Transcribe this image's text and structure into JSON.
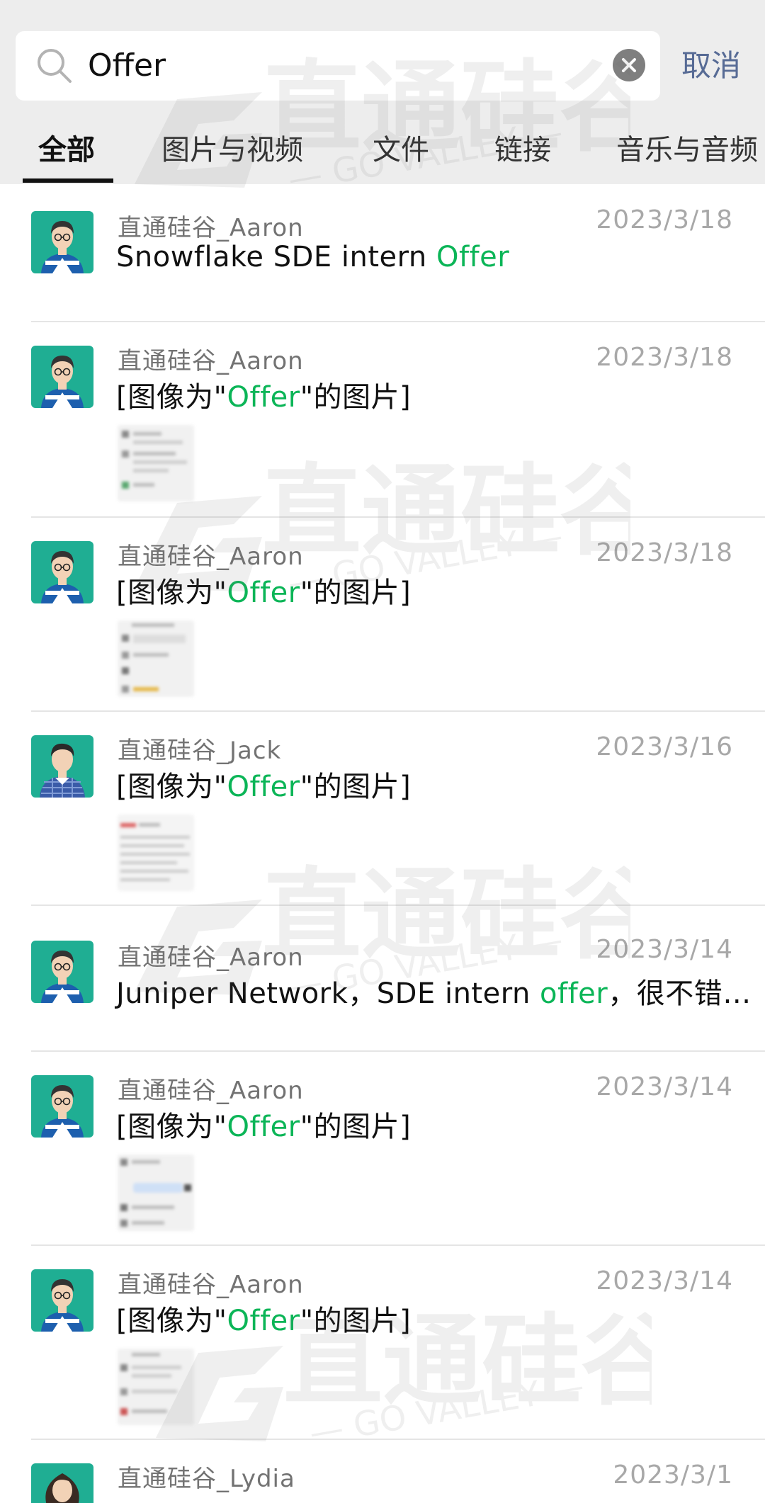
{
  "search": {
    "query": "Offer",
    "cancel_label": "取消"
  },
  "tabs": [
    {
      "label": "全部"
    },
    {
      "label": "图片与视频"
    },
    {
      "label": "文件"
    },
    {
      "label": "链接"
    },
    {
      "label": "音乐与音频"
    }
  ],
  "results": [
    {
      "sender": "直通硅谷_Aaron",
      "date": "2023/3/18",
      "msg_before": "Snowflake SDE intern ",
      "msg_hl": "Offer",
      "msg_after": "",
      "avatar": "aaron",
      "thumb": false
    },
    {
      "sender": "直通硅谷_Aaron",
      "date": "2023/3/18",
      "msg_before": "[图像为\"",
      "msg_hl": "Offer",
      "msg_after": "\"的图片]",
      "avatar": "aaron",
      "thumb": true
    },
    {
      "sender": "直通硅谷_Aaron",
      "date": "2023/3/18",
      "msg_before": "[图像为\"",
      "msg_hl": "Offer",
      "msg_after": "\"的图片]",
      "avatar": "aaron",
      "thumb": true
    },
    {
      "sender": "直通硅谷_Jack",
      "date": "2023/3/16",
      "msg_before": "[图像为\"",
      "msg_hl": "Offer",
      "msg_after": "\"的图片]",
      "avatar": "jack",
      "thumb": true
    },
    {
      "sender": "直通硅谷_Aaron",
      "date": "2023/3/14",
      "msg_before": "Juniper Network，SDE intern ",
      "msg_hl": "offer",
      "msg_after": "，很不错…",
      "avatar": "aaron",
      "thumb": false
    },
    {
      "sender": "直通硅谷_Aaron",
      "date": "2023/3/14",
      "msg_before": "[图像为\"",
      "msg_hl": "Offer",
      "msg_after": "\"的图片]",
      "avatar": "aaron",
      "thumb": true
    },
    {
      "sender": "直通硅谷_Aaron",
      "date": "2023/3/14",
      "msg_before": "[图像为\"",
      "msg_hl": "Offer",
      "msg_after": "\"的图片]",
      "avatar": "aaron",
      "thumb": true
    },
    {
      "sender": "直通硅谷_Lydia",
      "date": "2023/3/1",
      "msg_before": "",
      "msg_hl": "",
      "msg_after": "",
      "avatar": "lydia",
      "thumb": false
    }
  ],
  "watermark": {
    "brand": "直通硅谷",
    "sub": "— GO VALLEY —"
  },
  "colors": {
    "highlight": "#0bb557",
    "link": "#576b95",
    "avatar_bg": "#1fae93"
  }
}
